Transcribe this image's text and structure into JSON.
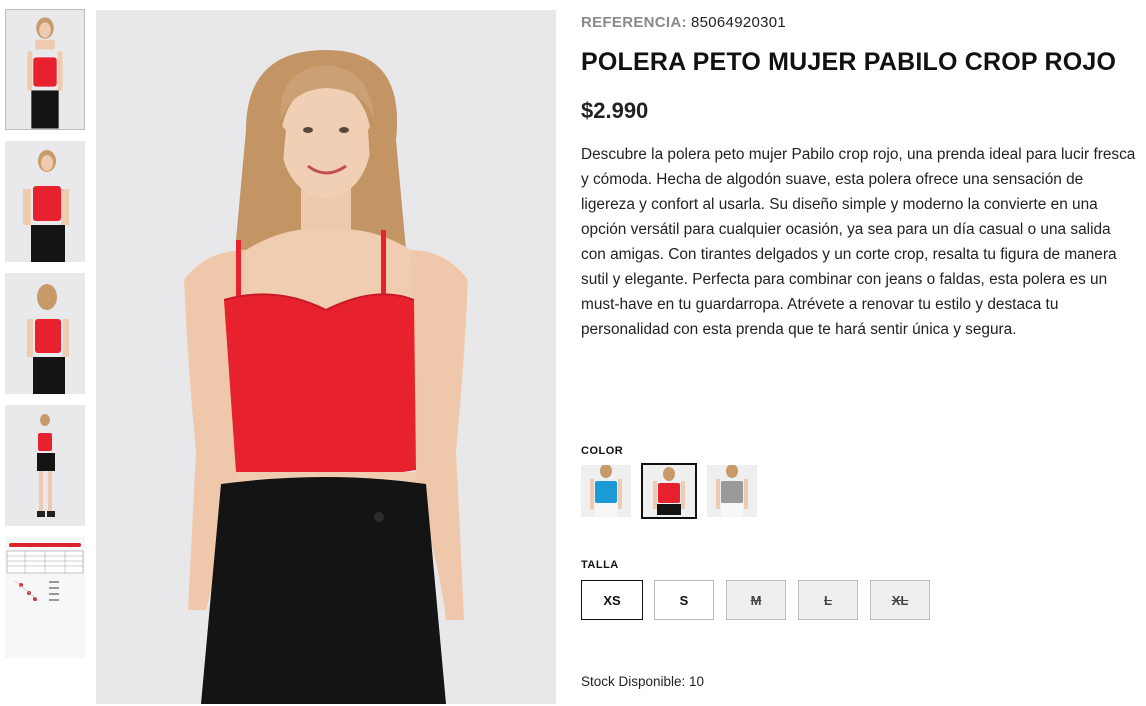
{
  "product": {
    "reference_label": "REFERENCIA:",
    "reference_value": "85064920301",
    "title": "POLERA PETO MUJER PABILO CROP ROJO",
    "price": "$2.990",
    "description": "Descubre la polera peto mujer Pabilo crop rojo, una prenda ideal para lucir fresca y cómoda. Hecha de algodón suave, esta polera ofrece una sensación de ligereza y confort al usarla. Su diseño simple y moderno la convierte en una opción versátil para cualquier ocasión, ya sea para un día casual o una salida con amigas. Con tirantes delgados y un corte crop, resalta tu figura de manera sutil y elegante. Perfecta para combinar con jeans o faldas, esta polera es un must-have en tu guardarropa. Atrévete a renovar tu estilo y destaca tu personalidad con esta prenda que te hará sentir única y segura."
  },
  "gallery": {
    "thumbnails": [
      "front-pose",
      "front-closeup",
      "back-view",
      "full-body",
      "size-chart"
    ],
    "active_index": 0
  },
  "color": {
    "label": "COLOR",
    "options": [
      {
        "name": "blue",
        "hex": "#1c9ad6"
      },
      {
        "name": "red",
        "hex": "#e8212e",
        "selected": true
      },
      {
        "name": "gray",
        "hex": "#9a9a9a"
      }
    ]
  },
  "size": {
    "label": "TALLA",
    "options": [
      {
        "label": "XS",
        "selected": true,
        "available": true
      },
      {
        "label": "S",
        "available": true
      },
      {
        "label": "M",
        "available": false
      },
      {
        "label": "L",
        "available": false
      },
      {
        "label": "XL",
        "available": false
      }
    ]
  },
  "stock": {
    "text": "Stock Disponible: 10"
  },
  "colors": {
    "top_red": "#e8212e",
    "skirt": "#141414",
    "background": "#e8e8ea"
  }
}
